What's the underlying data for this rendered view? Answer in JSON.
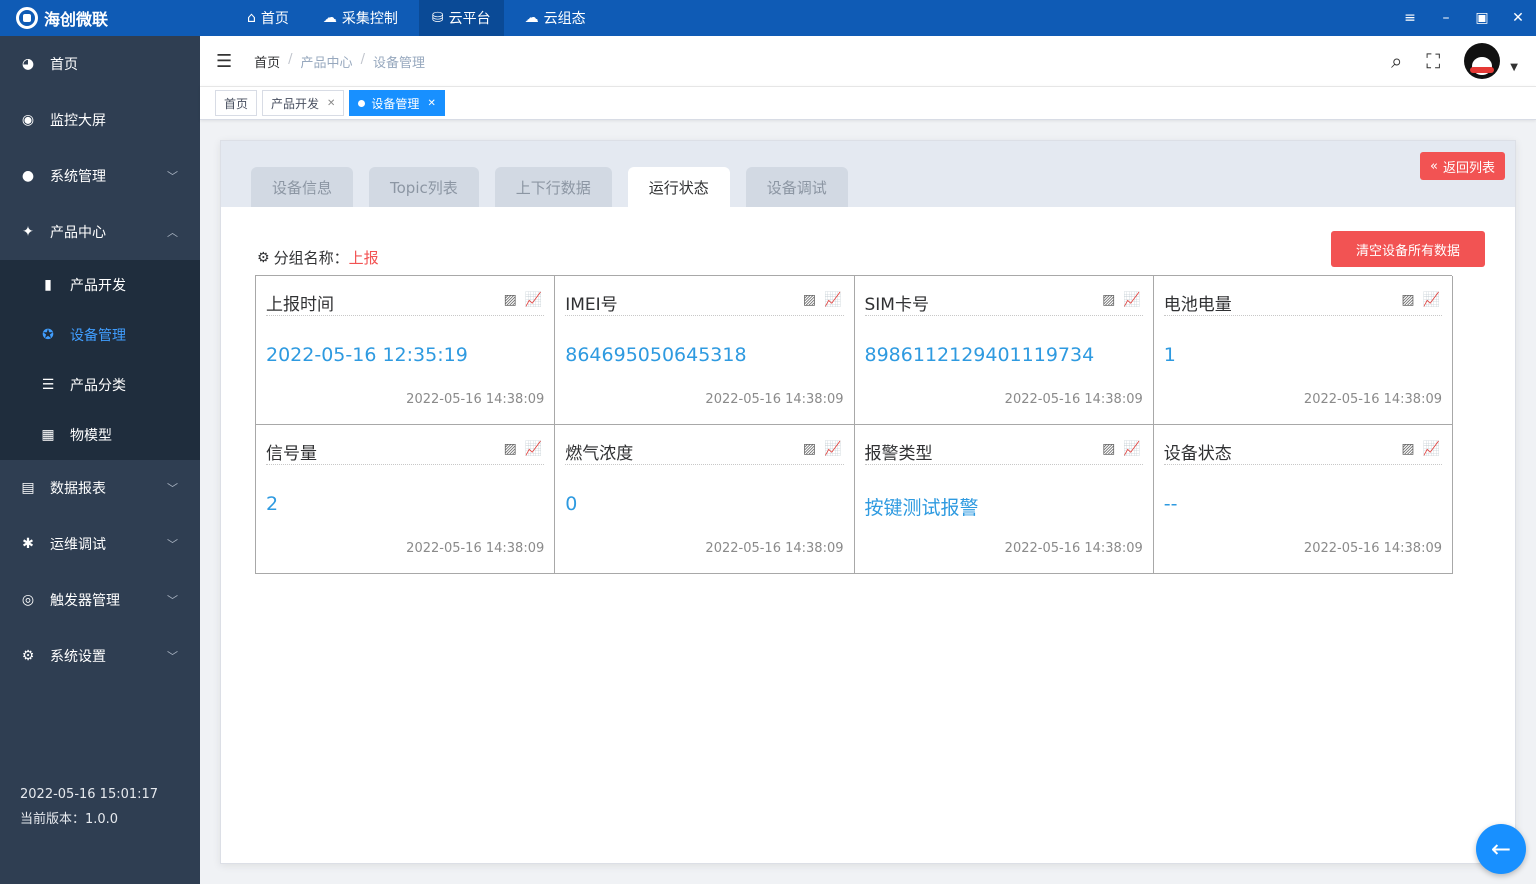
{
  "topbar": {
    "brand": "海创微联",
    "nav": [
      {
        "label": "首页",
        "icon": "home-icon",
        "glyph": "⌂"
      },
      {
        "label": "采集控制",
        "icon": "cloud-control-icon",
        "glyph": "☁"
      },
      {
        "label": "云平台",
        "icon": "cloud-platform-icon",
        "glyph": "⛁"
      },
      {
        "label": "云组态",
        "icon": "cloud-config-icon",
        "glyph": "☁"
      }
    ],
    "active_nav": 2
  },
  "sidebar": {
    "items": [
      {
        "label": "首页",
        "icon": "dashboard-icon",
        "glyph": "◕"
      },
      {
        "label": "监控大屏",
        "icon": "monitor-icon",
        "glyph": "◉"
      },
      {
        "label": "系统管理",
        "icon": "user-icon",
        "glyph": "👤"
      },
      {
        "label": "产品中心",
        "icon": "product-center-icon",
        "glyph": "✦"
      }
    ],
    "sub_items": [
      {
        "label": "产品开发",
        "icon": "product-dev-icon",
        "glyph": "▮"
      },
      {
        "label": "设备管理",
        "icon": "device-manage-icon",
        "glyph": "✪"
      },
      {
        "label": "产品分类",
        "icon": "product-category-icon",
        "glyph": "☰"
      },
      {
        "label": "物模型",
        "icon": "thing-model-icon",
        "glyph": "▦"
      }
    ],
    "items_after": [
      {
        "label": "数据报表",
        "icon": "report-icon",
        "glyph": "▤"
      },
      {
        "label": "运维调试",
        "icon": "debug-icon",
        "glyph": "✱"
      },
      {
        "label": "触发器管理",
        "icon": "trigger-icon",
        "glyph": "◎"
      },
      {
        "label": "系统设置",
        "icon": "settings-icon",
        "glyph": "⚙"
      }
    ],
    "datetime": "2022-05-16 15:01:17",
    "version": "当前版本：1.0.0"
  },
  "header": {
    "breadcrumb": [
      "首页",
      "产品中心",
      "设备管理"
    ]
  },
  "tags": [
    {
      "label": "首页"
    },
    {
      "label": "产品开发"
    },
    {
      "label": "设备管理"
    }
  ],
  "detail": {
    "tabs": [
      "设备信息",
      "Topic列表",
      "上下行数据",
      "运行状态",
      "设备调试"
    ],
    "active_tab": 3,
    "back_label": "返回列表",
    "group_label": "分组名称：",
    "group_value": "上报",
    "clear_label": "清空设备所有数据",
    "cells": [
      {
        "title": "上报时间",
        "value": "2022-05-16 12:35:19",
        "time": "2022-05-16 14:38:09"
      },
      {
        "title": "IMEI号",
        "value": "864695050645318",
        "time": "2022-05-16 14:38:09"
      },
      {
        "title": "SIM卡号",
        "value": "898611212940111 9734",
        "time": "2022-05-16 14:38:09"
      },
      {
        "title": "电池电量",
        "value": "1",
        "time": "2022-05-16 14:38:09"
      },
      {
        "title": "信号量",
        "value": "2",
        "time": "2022-05-16 14:38:09"
      },
      {
        "title": "燃气浓度",
        "value": "0",
        "time": "2022-05-16 14:38:09"
      },
      {
        "title": "报警类型",
        "value": "按键测试报警",
        "time": "2022-05-16 14:38:09"
      },
      {
        "title": "设备状态",
        "value": "--",
        "time": "2022-05-16 14:38:09"
      }
    ]
  }
}
